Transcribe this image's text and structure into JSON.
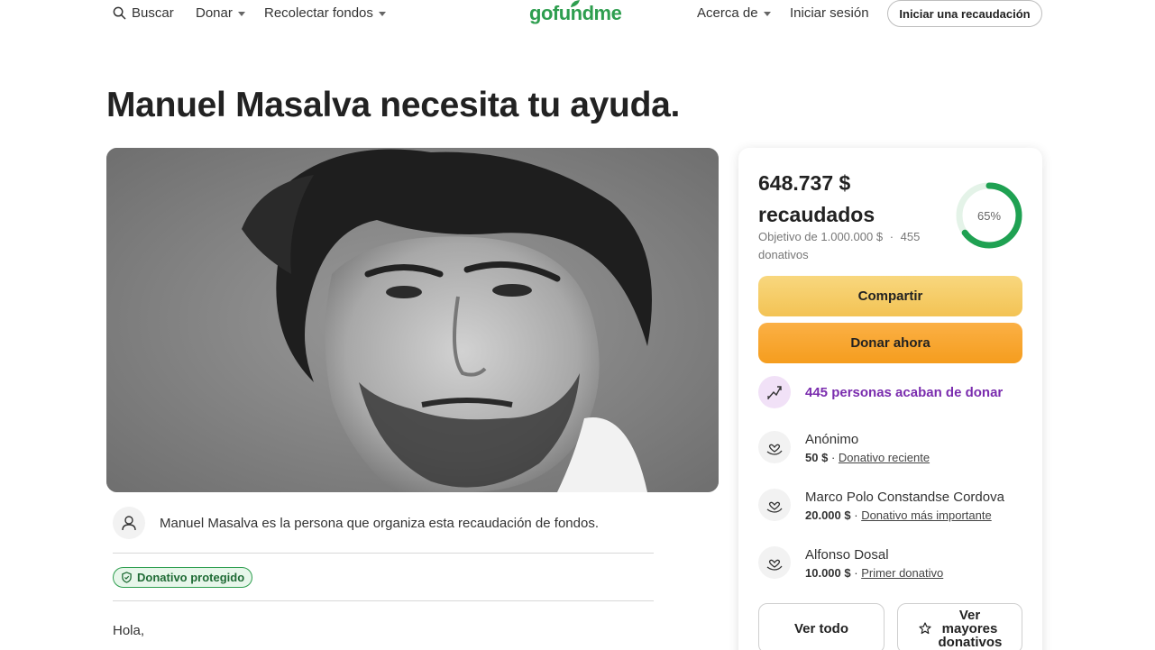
{
  "header": {
    "search_label": "Buscar",
    "donate_label": "Donar",
    "fundraise_label": "Recolectar fondos",
    "logo_text": "gofundme",
    "about_label": "Acerca de",
    "signin_label": "Iniciar sesión",
    "start_label": "Iniciar una recaudación"
  },
  "page": {
    "title": "Manuel Masalva necesita tu ayuda."
  },
  "hero": {
    "icon": "portrait-photo"
  },
  "organizer": {
    "text": "Manuel Masalva es la persona que organiza esta recaudación de fondos."
  },
  "badge": {
    "label": "Donativo protegido"
  },
  "story": {
    "greeting": "Hola,"
  },
  "card": {
    "raised_amount": "648.737 $",
    "raised_label": "recaudados",
    "goal_text": "Objetivo de 1.000.000 $",
    "separator": "·",
    "donations_count": "455",
    "donations_label": "donativos",
    "progress": 0.65,
    "progress_label": "65%",
    "share_label": "Compartir",
    "donate_label": "Donar ahora",
    "trend_text": "445 personas acaban de donar",
    "donors": [
      {
        "name": "Anónimo",
        "amount": "50 $",
        "tag": "Donativo reciente"
      },
      {
        "name": "Marco Polo Constandse Cordova",
        "amount": "20.000 $",
        "tag": "Donativo más importante"
      },
      {
        "name": "Alfonso Dosal",
        "amount": "10.000 $",
        "tag": "Primer donativo"
      }
    ],
    "see_all_label": "Ver todo",
    "top_donations_label": "Ver mayores donativos"
  },
  "colors": {
    "brand_green": "#2e9e4f",
    "share_yellow": "#f5c95f",
    "donate_orange": "#f7a42c",
    "trend_purple": "#7a2cae"
  }
}
